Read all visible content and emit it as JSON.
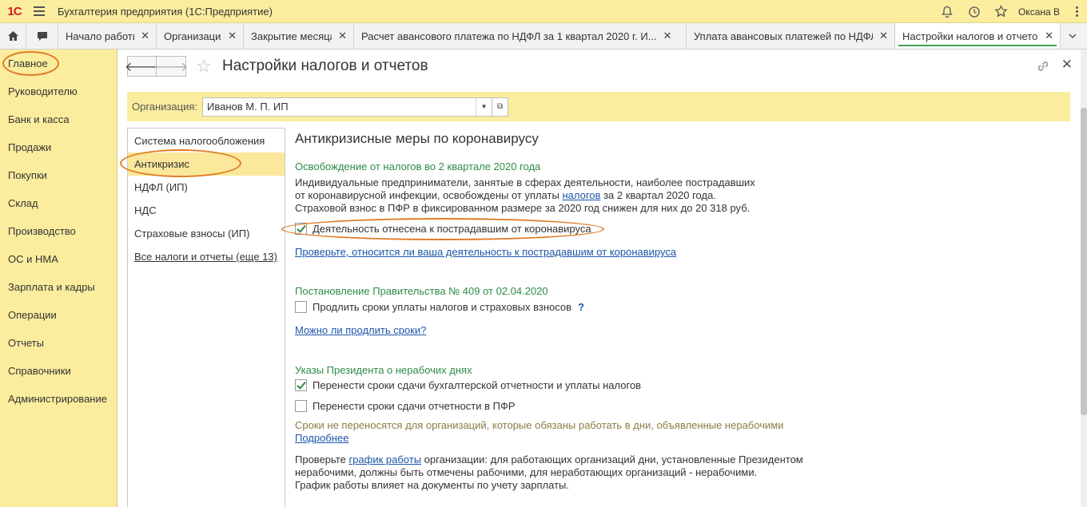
{
  "titlebar": {
    "logo_text": "1С",
    "title": "Бухгалтерия предприятия   (1С:Предприятие)",
    "user": "Оксана В"
  },
  "tabs": [
    {
      "label": "Начало работы"
    },
    {
      "label": "Организации"
    },
    {
      "label": "Закрытие месяца"
    },
    {
      "label": "Расчет авансового платежа по НДФЛ за 1 квартал 2020 г. И..."
    },
    {
      "label": "Уплата авансовых платежей по НДФЛ"
    },
    {
      "label": "Настройки налогов и отчетов"
    }
  ],
  "sections": [
    "Главное",
    "Руководителю",
    "Банк и касса",
    "Продажи",
    "Покупки",
    "Склад",
    "Производство",
    "ОС и НМА",
    "Зарплата и кадры",
    "Операции",
    "Отчеты",
    "Справочники",
    "Администрирование"
  ],
  "form": {
    "title": "Настройки налогов и отчетов",
    "org_label": "Организация:",
    "org_value": "Иванов М. П. ИП"
  },
  "navlist": [
    "Система налогообложения",
    "Антикризис",
    "НДФЛ (ИП)",
    "НДС",
    "Страховые взносы (ИП)",
    "Все налоги и отчеты (еще 13)"
  ],
  "content": {
    "heading": "Антикризисные меры по коронавирусу",
    "s1_title": "Освобождение от налогов во 2 квартале 2020 года",
    "s1_p1a": "Индивидуальные предприниматели, занятые в сферах деятельности, наиболее пострадавших",
    "s1_p1b_pre": "от коронавирусной инфекции, освобождены от уплаты ",
    "s1_p1b_link": "налогов",
    "s1_p1b_post": " за 2 квартал 2020 года.",
    "s1_p1c": "Страховой взнос в ПФР в фиксированном размере за 2020 год снижен для них до 20 318 руб.",
    "s1_checkbox": "Деятельность отнесена к пострадавшим от коронавируса",
    "s1_link": "Проверьте, относится ли ваша деятельность к пострадавшим от коронавируса",
    "s2_title": "Постановление Правительства № 409 от 02.04.2020",
    "s2_checkbox": "Продлить сроки уплаты налогов и страховых взносов",
    "s2_help": "?",
    "s2_link": "Можно ли продлить сроки?",
    "s3_title": "Указы Президента о нерабочих днях",
    "s3_cb1": "Перенести сроки сдачи бухгалтерской отчетности и уплаты налогов",
    "s3_cb2": "Перенести сроки сдачи отчетности в ПФР",
    "s3_note": "Сроки не переносятся для организаций, которые обязаны работать в дни, объявленные нерабочими",
    "s3_more": "Подробнее",
    "s3_p1_pre": "Проверьте ",
    "s3_p1_link": "график работы",
    "s3_p1_post": " организации: для работающих организаций дни, установленные Президентом",
    "s3_p2": "нерабочими, должны быть отмечены рабочими, для неработающих организаций - нерабочими.",
    "s3_p3": "График работы влияет на документы по учету зарплаты."
  },
  "colors": {
    "accent_yellow": "#fbed9e",
    "green": "#2e8b47",
    "link": "#1c56a8",
    "highlight_circle": "#e07b24"
  }
}
